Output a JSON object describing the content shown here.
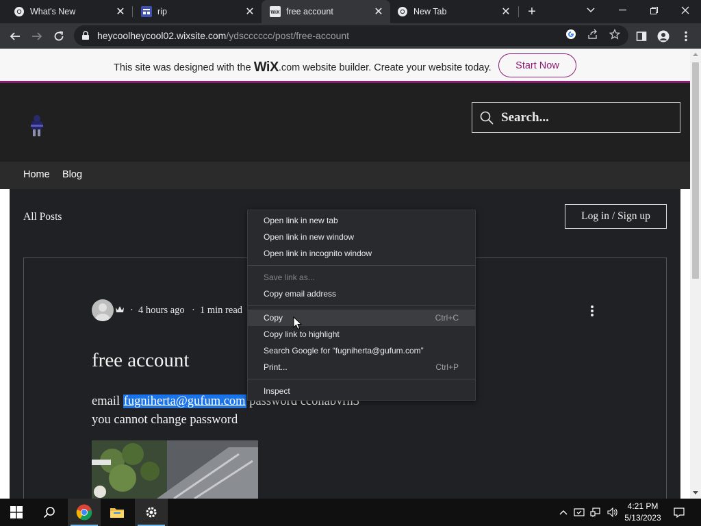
{
  "browser": {
    "tabs": [
      {
        "title": "What's New",
        "icon": "chrome-icon",
        "active": false
      },
      {
        "title": "rip",
        "icon": "site-icon",
        "active": false
      },
      {
        "title": "free account",
        "icon": "wix-icon",
        "active": true
      },
      {
        "title": "New Tab",
        "icon": "chrome-icon",
        "active": false
      }
    ],
    "url_host": "heycoolheycool02.wixsite.com",
    "url_path": "/ydscccccc/post/free-account"
  },
  "wix_banner": {
    "text_before": "This site was designed with the ",
    "wix_logo": "WiX",
    "text_after": ".com website builder. Create your website today.",
    "button": "Start Now",
    "accent": "#8a1c74"
  },
  "site": {
    "search_placeholder": "Search...",
    "nav": [
      "Home",
      "Blog"
    ],
    "all_posts": "All Posts",
    "login": "Log in / Sign up"
  },
  "post": {
    "time": "4 hours ago",
    "read": "1 min read",
    "title": "free account",
    "line1_prefix": "email ",
    "email": "fugniherta@gufum.com",
    "line1_suffix": " password cconabvrn3",
    "line2": "you cannot change password"
  },
  "context_menu": {
    "items": [
      {
        "label": "Open link in new tab",
        "shortcut": ""
      },
      {
        "label": "Open link in new window",
        "shortcut": ""
      },
      {
        "label": "Open link in incognito window",
        "shortcut": ""
      },
      {
        "label": "Save link as...",
        "shortcut": "",
        "disabled": true
      },
      {
        "label": "Copy email address",
        "shortcut": ""
      },
      {
        "label": "Copy",
        "shortcut": "Ctrl+C",
        "highlighted": true
      },
      {
        "label": "Copy link to highlight",
        "shortcut": ""
      },
      {
        "label": "Search Google for “fugniherta@gufum.com”",
        "shortcut": ""
      },
      {
        "label": "Print...",
        "shortcut": "Ctrl+P"
      },
      {
        "label": "Inspect",
        "shortcut": ""
      }
    ]
  },
  "taskbar": {
    "time": "4:21 PM",
    "date": "5/13/2023"
  }
}
